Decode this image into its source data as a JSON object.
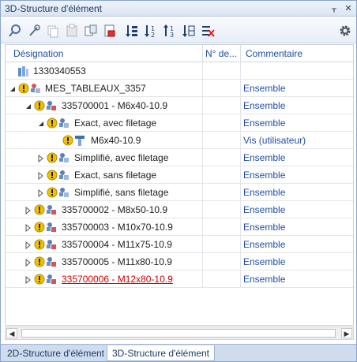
{
  "window": {
    "title": "3D-Structure d'élément",
    "pin_icon": "pin-icon",
    "close_icon": "close-icon"
  },
  "toolbar": {
    "buttons": [
      "search-icon",
      "tools-icon",
      "copy-icon",
      "paste-icon",
      "paste-structure-icon",
      "delete-list-icon",
      "sort-asc-icon",
      "sort-down-icon",
      "sort-level-icon",
      "sort-column-icon",
      "clear-filter-icon"
    ],
    "settings_icon": "gear-icon"
  },
  "columns": {
    "designation": "Désignation",
    "number": "N° de...",
    "comment": "Commentaire"
  },
  "rows": [
    {
      "label": "1330340553",
      "comment": ""
    },
    {
      "label": "MES_TABLEAUX_3357",
      "comment": "Ensemble"
    },
    {
      "label": "335700001 - M6x40-10.9",
      "comment": "Ensemble"
    },
    {
      "label": "Exact, avec filetage",
      "comment": "Ensemble"
    },
    {
      "label": "M6x40-10.9",
      "comment": "Vis (utilisateur)"
    },
    {
      "label": "Simplifié, avec filetage",
      "comment": "Ensemble"
    },
    {
      "label": "Exact, sans filetage",
      "comment": "Ensemble"
    },
    {
      "label": "Simplifié, sans filetage",
      "comment": "Ensemble"
    },
    {
      "label": "335700002 - M8x50-10.9",
      "comment": "Ensemble"
    },
    {
      "label": "335700003 - M10x70-10.9",
      "comment": "Ensemble"
    },
    {
      "label": "335700004 - M11x75-10.9",
      "comment": "Ensemble"
    },
    {
      "label": "335700005 - M11x80-10.9",
      "comment": "Ensemble"
    },
    {
      "label": "335700006 - M12x80-10.9",
      "comment": "Ensemble"
    }
  ],
  "tabs": [
    "2D-Structure d'élément",
    "3D-Structure d'élément"
  ],
  "colors": {
    "link_blue": "#1f4fa3",
    "highlight_red": "#d00000",
    "warning_yellow": "#f2c200"
  }
}
